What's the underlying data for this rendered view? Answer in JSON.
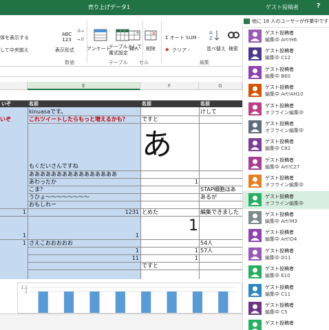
{
  "title_bar": {
    "doc_title": "売り上げデータ1",
    "guest_label": "ゲスト投稿者",
    "help_label": "?"
  },
  "collab": {
    "message": "他に 18 人のユーザーが作業中です -"
  },
  "ribbon": {
    "wrap_text": "体を表示する",
    "merge_center": "して中央揃え",
    "number_format_preview": "ABC\n123",
    "number_format_label": "表示形式",
    "group_number": "数値",
    "conditional_label": "アンケート",
    "format_as_table_label": "テーブルとして\n書式設定",
    "group_table": "テーブル",
    "insert_label": "挿入",
    "delete_label": "削除",
    "group_cells": "セル",
    "autosum_label": "Σ オート SUM -",
    "clear_label": "クリア -",
    "sort_label": "並べ替え",
    "find_label": "検索",
    "group_editing": "編集"
  },
  "columns": {
    "e": "E",
    "f": "F",
    "g": "G"
  },
  "header_row": {
    "col_left": "いぞ",
    "col_e": "名前",
    "col_f": "名前",
    "col_g": "名前"
  },
  "cells": {
    "r1_e": "kinuasaです。",
    "r1_g": "けして",
    "r2_e": "これツイートしたらもっと増えるかも？",
    "r2_f": "ですと",
    "big_a": "あ",
    "r4_e": "もくだいさんですね",
    "r5_e": "ああああああああああああああああ",
    "r6_e": "あわったか",
    "r6_f": "1",
    "r7_e": "こま？",
    "r7_g": "STAP細胞はあ",
    "r8_e": "うひょ～～～～～～～～",
    "r8_g": "あるが",
    "r9_e": "おもしれー",
    "r10_left": "1",
    "r10_e": "1231",
    "r10_f": "とめた",
    "r10_g": "編集できました",
    "big_1": "1",
    "r12_left": "1",
    "r12_e": "1",
    "r13_left": "1",
    "r13_e": "さえこおおおおお",
    "r13_g": "54人",
    "r14_e": "1",
    "r14_f": "1",
    "r14_g": "57人",
    "r15_e": "11",
    "r15_f": "1",
    "r16_f": "ですと"
  },
  "chart_data": {
    "type": "bar",
    "categories": [
      "",
      "",
      "",
      "",
      "",
      "",
      "",
      ""
    ],
    "values": [
      1,
      1,
      1,
      1,
      1,
      1,
      1,
      1
    ],
    "ylim": [
      0,
      1.2
    ],
    "ytick_labels": [
      "1.2",
      "1"
    ]
  },
  "accent_colors": {
    "excel_green": "#217346",
    "selection_blue": "#c5d9f1",
    "bar_blue": "#5b9bd5",
    "highlight_green": "#d7eee0"
  },
  "users": [
    {
      "name": "ゲスト投稿者",
      "status": "編集中 Art!H6",
      "color": "#9b59b6"
    },
    {
      "name": "ゲスト投稿者",
      "status": "編集中 C12",
      "color": "#4b3a8c"
    },
    {
      "name": "ゲスト投稿者",
      "status": "編集中 B60",
      "color": "#8e44ad"
    },
    {
      "name": "ゲスト投稿者",
      "status": "編集中 Art!AH10",
      "color": "#d35400"
    },
    {
      "name": "ゲスト投稿者",
      "status": "オフライン編集中",
      "color": "#bd3e86"
    },
    {
      "name": "ゲスト投稿者",
      "status": "オフライン編集中",
      "color": "#5d6d7e"
    },
    {
      "name": "ゲスト投稿者",
      "status": "編集中 C82",
      "color": "#7d3c98"
    },
    {
      "name": "ゲスト投稿者",
      "status": "編集中 Art!C27",
      "color": "#a93c93"
    },
    {
      "name": "ゲスト投稿者",
      "status": "オフライン編集中",
      "color": "#e67e22"
    },
    {
      "name": "ゲスト投稿者",
      "status": "オフライン編集中",
      "color": "#27ae60"
    },
    {
      "name": "ゲスト投稿者",
      "status": "編集中 Art!M3",
      "color": "#7f8c8d"
    },
    {
      "name": "ゲスト投稿者",
      "status": "編集中 Art!D4",
      "color": "#8e44ad"
    },
    {
      "name": "ゲスト投稿者",
      "status": "編集中 D11",
      "color": "#9b59b6"
    },
    {
      "name": "ゲスト投稿者",
      "status": "編集中 E10",
      "color": "#27ae60"
    },
    {
      "name": "ゲスト投稿者",
      "status": "編集中 C11",
      "color": "#2e86c1"
    },
    {
      "name": "ゲスト投稿者",
      "status": "編集中 C5",
      "color": "#6c3483"
    },
    {
      "name": "ゲスト投稿者",
      "status": "",
      "color": "#27ae60"
    }
  ]
}
